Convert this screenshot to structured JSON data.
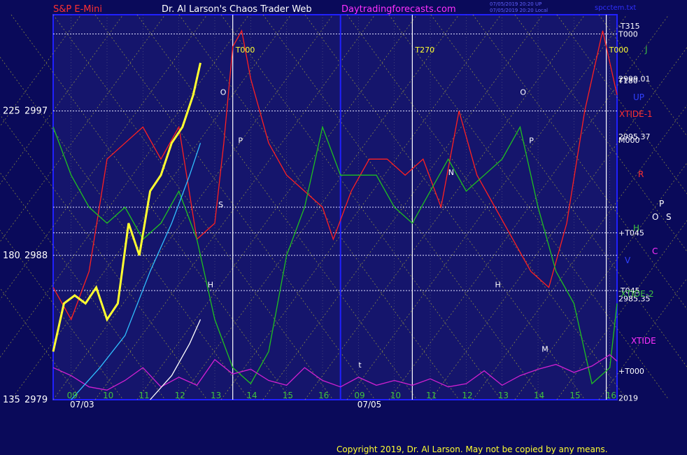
{
  "header": {
    "left_title": "S&P E-Mini",
    "center_title": "Dr. Al Larson's Chaos Trader Web",
    "site": "Daytradingforecasts.com",
    "stamp1": "07/05/2019 20:20 UP",
    "stamp2": "07/05/2019 20:20 Local",
    "file": "spcctem.txt"
  },
  "copyright": "Copyright 2019, Dr. Al Larson. May not be copied by any means.",
  "colors": {
    "background": "#0a0a5a",
    "panel": "#15156c",
    "border": "#2020ff",
    "title_red": "#ff3030",
    "site_magenta": "#ff30ff",
    "price_red": "#ff2020",
    "tide1_red": "#ff2020",
    "tide2_green": "#20c020",
    "xtide_magenta": "#d020d0",
    "cyan": "#30c0ff",
    "yellow": "#ffff30"
  },
  "chart_data": {
    "type": "line",
    "instrument": "S&P E-Mini",
    "y_axis": {
      "range": [
        2979,
        3003
      ],
      "ticks": [
        {
          "left": "225",
          "right": "2997",
          "value": 2997
        },
        {
          "left": "180",
          "right": "2988",
          "value": 2988
        },
        {
          "left": "135",
          "right": "2979",
          "value": 2979
        }
      ]
    },
    "x_axis": {
      "dates": [
        "07/03",
        "07/05"
      ],
      "hours": [
        "09",
        "10",
        "11",
        "12",
        "13",
        "14",
        "15",
        "16",
        "09",
        "10",
        "11",
        "12",
        "13",
        "14",
        "15",
        "16"
      ],
      "range_hours": [
        8.5,
        24.2
      ],
      "date_label_positions": [
        8.5,
        16.5
      ]
    },
    "right_labels": [
      {
        "text": "-T315",
        "value": 3002.3
      },
      {
        "text": "T000",
        "value": 3001.8
      },
      {
        "text": "2999.01",
        "value": 2999.0
      },
      {
        "text": "T180",
        "value": 2998.9
      },
      {
        "text": "2995.37",
        "value": 2995.4
      },
      {
        "text": "M000",
        "value": 2995.2
      },
      {
        "text": "+T045",
        "value": 2989.4
      },
      {
        "text": "-T045",
        "value": 2985.8
      },
      {
        "text": "2985.35",
        "value": 2985.3
      },
      {
        "text": "+T000",
        "value": 2980.8
      },
      {
        "text": "2019",
        "value": 2979.1
      }
    ],
    "side_labels": [
      "J",
      "UP",
      "XTIDE-1",
      "R",
      "P",
      "O",
      "S",
      "H",
      "C",
      "V",
      "XTIDE-2",
      "XTIDE"
    ],
    "series": [
      {
        "name": "Price",
        "color": "#ff2020",
        "x": [
          8.5,
          9.0,
          9.5,
          10.0,
          10.5,
          11.0,
          11.5,
          12.0,
          12.5,
          13.0,
          13.25,
          13.5,
          13.75,
          14.0,
          14.5,
          15.0,
          15.5,
          16.0,
          16.3,
          16.8,
          17.3,
          17.8,
          18.3,
          18.8,
          19.3,
          19.8,
          20.3,
          20.8,
          21.3,
          21.8,
          22.3,
          22.8,
          23.3,
          23.8,
          24.2
        ],
        "values": [
          2986,
          2984,
          2987,
          2994,
          2995,
          2996,
          2994,
          2996,
          2989,
          2990,
          2995,
          3001,
          3002,
          2999,
          2995,
          2993,
          2992,
          2991,
          2989,
          2992,
          2994,
          2994,
          2993,
          2994,
          2991,
          2997,
          2993,
          2991,
          2989,
          2987,
          2986,
          2990,
          2997,
          3002,
          2998
        ]
      },
      {
        "name": "XTIDE-1",
        "color": "#20c020",
        "x": [
          8.5,
          9.0,
          9.5,
          10.0,
          10.5,
          11.0,
          11.5,
          12.0,
          12.5,
          13.0,
          13.5,
          14.0,
          14.5,
          15.0,
          15.5,
          16.0,
          16.5,
          17.0,
          17.5,
          18.0,
          18.5,
          19.0,
          19.5,
          20.0,
          20.5,
          21.0,
          21.5,
          22.0,
          22.5,
          23.0,
          23.5,
          24.0,
          24.2
        ],
        "values": [
          2996,
          2993,
          2991,
          2990,
          2991,
          2989,
          2990,
          2992,
          2989,
          2984,
          2981,
          2980,
          2982,
          2988,
          2991,
          2996,
          2993,
          2993,
          2993,
          2991,
          2990,
          2992,
          2994,
          2992,
          2993,
          2994,
          2996,
          2991,
          2987,
          2985,
          2980,
          2981,
          2985
        ]
      },
      {
        "name": "XTIDE",
        "color": "#d020d0",
        "x": [
          8.5,
          9.0,
          9.5,
          10.0,
          10.5,
          11.0,
          11.5,
          12.0,
          12.5,
          13.0,
          13.5,
          14.0,
          14.5,
          15.0,
          15.5,
          16.0,
          16.5,
          17.0,
          17.5,
          18.0,
          18.5,
          19.0,
          19.5,
          20.0,
          20.5,
          21.0,
          21.5,
          22.0,
          22.5,
          23.0,
          23.5,
          24.0,
          24.2
        ],
        "values": [
          2981.0,
          2980.5,
          2979.8,
          2979.6,
          2980.2,
          2981.0,
          2979.8,
          2980.4,
          2979.9,
          2981.5,
          2980.6,
          2980.9,
          2980.2,
          2979.9,
          2981.0,
          2980.2,
          2979.8,
          2980.4,
          2979.9,
          2980.2,
          2979.9,
          2980.3,
          2979.8,
          2980.0,
          2980.8,
          2979.9,
          2980.5,
          2980.9,
          2981.2,
          2980.7,
          2981.1,
          2981.8,
          2981.4
        ]
      },
      {
        "name": "Cyan",
        "color": "#30c0ff",
        "x": [
          9.0,
          9.8,
          10.5,
          11.2,
          11.8,
          12.3,
          12.6
        ],
        "values": [
          2979,
          2981,
          2983,
          2987,
          2990,
          2993,
          2995
        ]
      },
      {
        "name": "White",
        "color": "#ffffff",
        "x": [
          11.2,
          11.8,
          12.3,
          12.6
        ],
        "values": [
          2979,
          2980.5,
          2982.5,
          2984
        ]
      },
      {
        "name": "Yellow Price",
        "color": "#ffff30",
        "x": [
          8.5,
          8.8,
          9.1,
          9.4,
          9.7,
          10.0,
          10.3,
          10.6,
          10.9,
          11.2,
          11.5,
          11.8,
          12.1,
          12.4,
          12.6
        ],
        "values": [
          2982,
          2985,
          2985.5,
          2985,
          2986,
          2984,
          2985,
          2990,
          2988,
          2992,
          2993,
          2995,
          2996,
          2998,
          3000
        ]
      }
    ],
    "vertical_markers": [
      {
        "text": "T000",
        "x": 13.5
      },
      {
        "text": "T270",
        "x": 18.5
      },
      {
        "text": "T000",
        "x": 23.9
      }
    ],
    "point_labels": [
      {
        "text": "O",
        "x": 13.15,
        "value": 2998
      },
      {
        "text": "P",
        "x": 13.65,
        "value": 2995
      },
      {
        "text": "H",
        "x": 12.8,
        "value": 2986
      },
      {
        "text": "N",
        "x": 19.5,
        "value": 2993
      },
      {
        "text": "O",
        "x": 21.5,
        "value": 2998
      },
      {
        "text": "P",
        "x": 21.75,
        "value": 2995
      },
      {
        "text": "H",
        "x": 20.8,
        "value": 2986
      },
      {
        "text": "M",
        "x": 22.1,
        "value": 2982
      },
      {
        "text": "S",
        "x": 13.1,
        "value": 2991
      },
      {
        "text": "t",
        "x": 17.0,
        "value": 2981
      }
    ]
  }
}
